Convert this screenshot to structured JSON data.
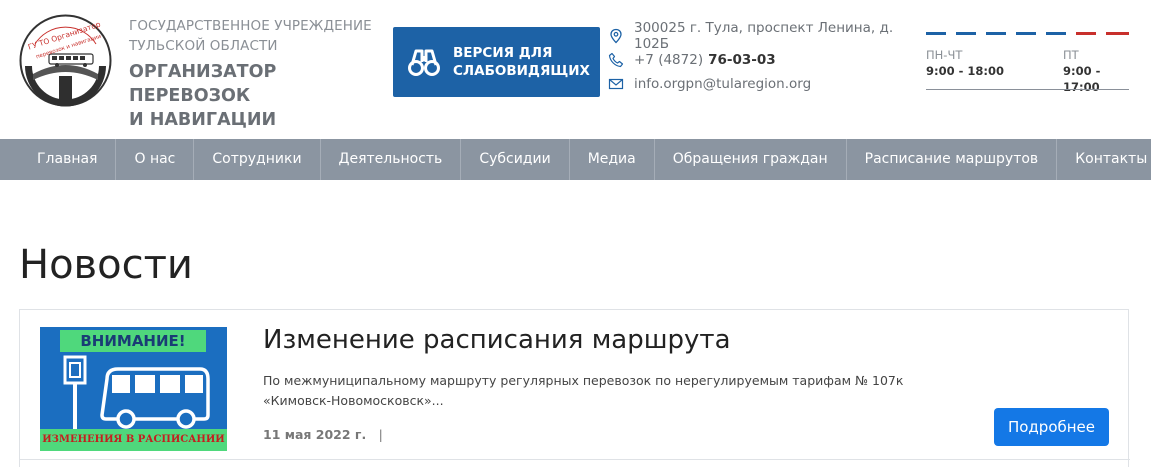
{
  "header": {
    "org_subtitle_line1": "ГОСУДАРСТВЕННОЕ УЧРЕЖДЕНИЕ",
    "org_subtitle_line2": "ТУЛЬСКОЙ ОБЛАСТИ",
    "org_title_line1": "ОРГАНИЗАТОР ПЕРЕВОЗОК",
    "org_title_line2": "И НАВИГАЦИИ",
    "logo_text": "ГУ ТО Организатор перевозок и навигации",
    "vision_button": {
      "line1": "ВЕРСИЯ ДЛЯ",
      "line2": "СЛАБОВИДЯЩИХ"
    },
    "contacts": {
      "address": "300025 г. Тула, проспект Ленина, д. 102Б",
      "phone_prefix": "+7 (4872)",
      "phone_number": "76-03-03",
      "email": "info.orgpn@tularegion.org"
    },
    "hours": {
      "weekdays_label": "ПН-ЧТ",
      "weekdays_value": "9:00 - 18:00",
      "friday_label": "ПТ",
      "friday_value": "9:00 - 17:00"
    }
  },
  "nav": {
    "items": [
      "Главная",
      "О нас",
      "Сотрудники",
      "Деятельность",
      "Субсидии",
      "Медиа",
      "Обращения граждан",
      "Расписание маршрутов",
      "Контакты"
    ]
  },
  "main": {
    "page_title": "Новости",
    "news": [
      {
        "image_banner_top": "ВНИМАНИЕ!",
        "image_banner_bottom": "ИЗМЕНЕНИЯ В РАСПИСАНИИ",
        "title": "Изменение расписания маршрута",
        "excerpt_line1": "По межмуниципальному маршруту регулярных перевозок по нерегулируемым тарифам № 107к",
        "excerpt_line2": "«Кимовск-Новомосковск»...",
        "date": "11 мая 2022 г.",
        "separator": "|",
        "more_label": "Подробнее"
      }
    ]
  },
  "colors": {
    "brand_blue": "#1d62a6",
    "nav_bg": "#8b95a1",
    "button_blue": "#1478e6",
    "dash_blue": "#1d62a6",
    "dash_red": "#c8302c"
  },
  "icons": {
    "vision": "binoculars-icon",
    "address": "location-pin-icon",
    "phone": "phone-icon",
    "email": "envelope-icon"
  }
}
